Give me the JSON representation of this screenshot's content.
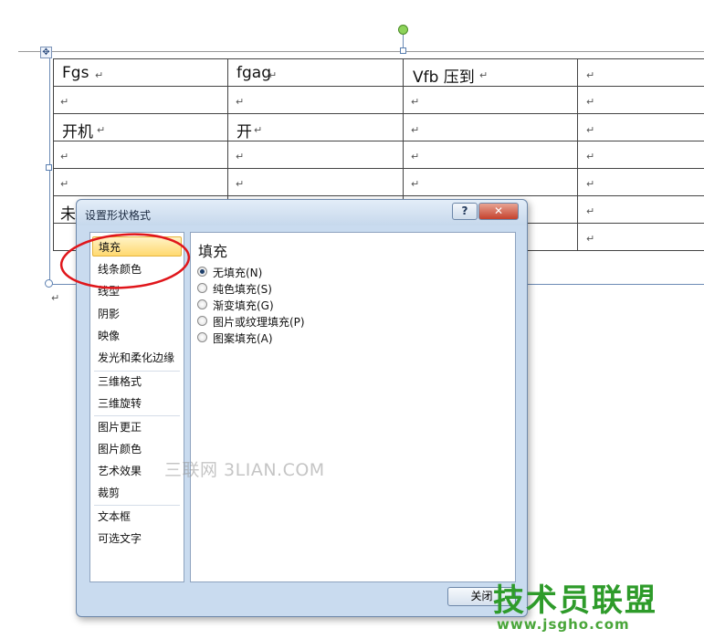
{
  "table": {
    "row1": {
      "c1": "Fgs",
      "c2": "fgag",
      "c3": "Vfb 压到"
    },
    "row3": {
      "c1": "开机",
      "c2": "开"
    },
    "row6": {
      "c1": "未"
    },
    "paragraph_mark": "↵"
  },
  "dialog": {
    "title": "设置形状格式",
    "help_label": "?",
    "close_x_label": "✕",
    "nav_items": [
      "填充",
      "线条颜色",
      "线型",
      "阴影",
      "映像",
      "发光和柔化边缘",
      "三维格式",
      "三维旋转",
      "图片更正",
      "图片颜色",
      "艺术效果",
      "裁剪",
      "文本框",
      "可选文字"
    ],
    "panel_heading": "填充",
    "fill_options": [
      {
        "label": "无填充(N)",
        "checked": true
      },
      {
        "label": "纯色填充(S)",
        "checked": false
      },
      {
        "label": "渐变填充(G)",
        "checked": false
      },
      {
        "label": "图片或纹理填充(P)",
        "checked": false
      },
      {
        "label": "图案填充(A)",
        "checked": false
      }
    ],
    "close_button_label": "关闭"
  },
  "watermarks": {
    "center": "三联网 3LIAN.COM",
    "logo": "技术员联盟",
    "url": "www.jsgho.com"
  },
  "colors": {
    "annotation_red": "#e0161b",
    "nav_selected": "#ffd970",
    "logo_green": "#2e9b2a"
  },
  "icons": {
    "move_handle": "four-way-arrow-icon",
    "rotate_handle": "rotate-handle-icon"
  }
}
